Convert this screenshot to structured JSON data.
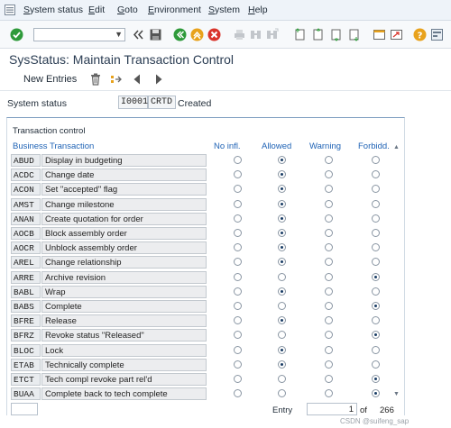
{
  "menubar": {
    "items": [
      {
        "mnemonic": "S",
        "rest": "ystem status"
      },
      {
        "mnemonic": "E",
        "rest": "dit"
      },
      {
        "mnemonic": "G",
        "rest": "oto"
      },
      {
        "mnemonic": "E",
        "rest": "nvironment"
      },
      {
        "mnemonic": "S",
        "rest": "ystem"
      },
      {
        "mnemonic": "H",
        "rest": "elp"
      }
    ]
  },
  "toolbar": {
    "command_field": "",
    "icons": [
      "check-icon",
      "back-icon",
      "save-icon",
      "green-back-icon",
      "exit-icon",
      "cancel-icon",
      "print-icon",
      "find-icon",
      "find-next-icon",
      "first-page-icon",
      "prev-page-icon",
      "next-page-icon",
      "last-page-icon",
      "new-session-icon",
      "shortcut-icon",
      "help-icon",
      "layout-icon"
    ]
  },
  "title": "SysStatus: Maintain Transaction Control",
  "app_toolbar": {
    "new_entries": "New Entries"
  },
  "status": {
    "label": "System status",
    "code": "I0001",
    "abbr": "CRTD",
    "text": "Created"
  },
  "group": {
    "title": "Transaction control",
    "headers": {
      "business_transaction": "Business Transaction",
      "no_infl": "No infl.",
      "allowed": "Allowed",
      "warning": "Warning",
      "forbidd": "Forbidd."
    }
  },
  "rows": [
    {
      "code": "ABUD",
      "desc": "Display in budgeting",
      "selected": "allowed"
    },
    {
      "code": "ACDC",
      "desc": "Change date",
      "selected": "allowed"
    },
    {
      "code": "ACON",
      "desc": "Set \"accepted\" flag",
      "selected": "allowed"
    },
    {
      "code": "AMST",
      "desc": "Change milestone",
      "selected": "allowed"
    },
    {
      "code": "ANAN",
      "desc": "Create quotation for order",
      "selected": "allowed"
    },
    {
      "code": "AOCB",
      "desc": "Block assembly order",
      "selected": "allowed"
    },
    {
      "code": "AOCR",
      "desc": "Unblock assembly order",
      "selected": "allowed"
    },
    {
      "code": "AREL",
      "desc": "Change relationship",
      "selected": "allowed"
    },
    {
      "code": "ARRE",
      "desc": "Archive revision",
      "selected": "forbidd"
    },
    {
      "code": "BABL",
      "desc": "Wrap",
      "selected": "allowed"
    },
    {
      "code": "BABS",
      "desc": "Complete",
      "selected": "forbidd"
    },
    {
      "code": "BFRE",
      "desc": "Release",
      "selected": "allowed"
    },
    {
      "code": "BFRZ",
      "desc": "Revoke status \"Released\"",
      "selected": "forbidd"
    },
    {
      "code": "BLOC",
      "desc": "Lock",
      "selected": "allowed"
    },
    {
      "code": "ETAB",
      "desc": "Technically complete",
      "selected": "allowed"
    },
    {
      "code": "ETCT",
      "desc": "Tech compl revoke part rel'd",
      "selected": "forbidd"
    },
    {
      "code": "BUAA",
      "desc": "Complete back to tech complete",
      "selected": "forbidd"
    }
  ],
  "footer": {
    "entry_label": "Entry",
    "entry_value": "1",
    "of_label": "of",
    "total": "266"
  },
  "watermark": "CSDN @suifeng_sap"
}
